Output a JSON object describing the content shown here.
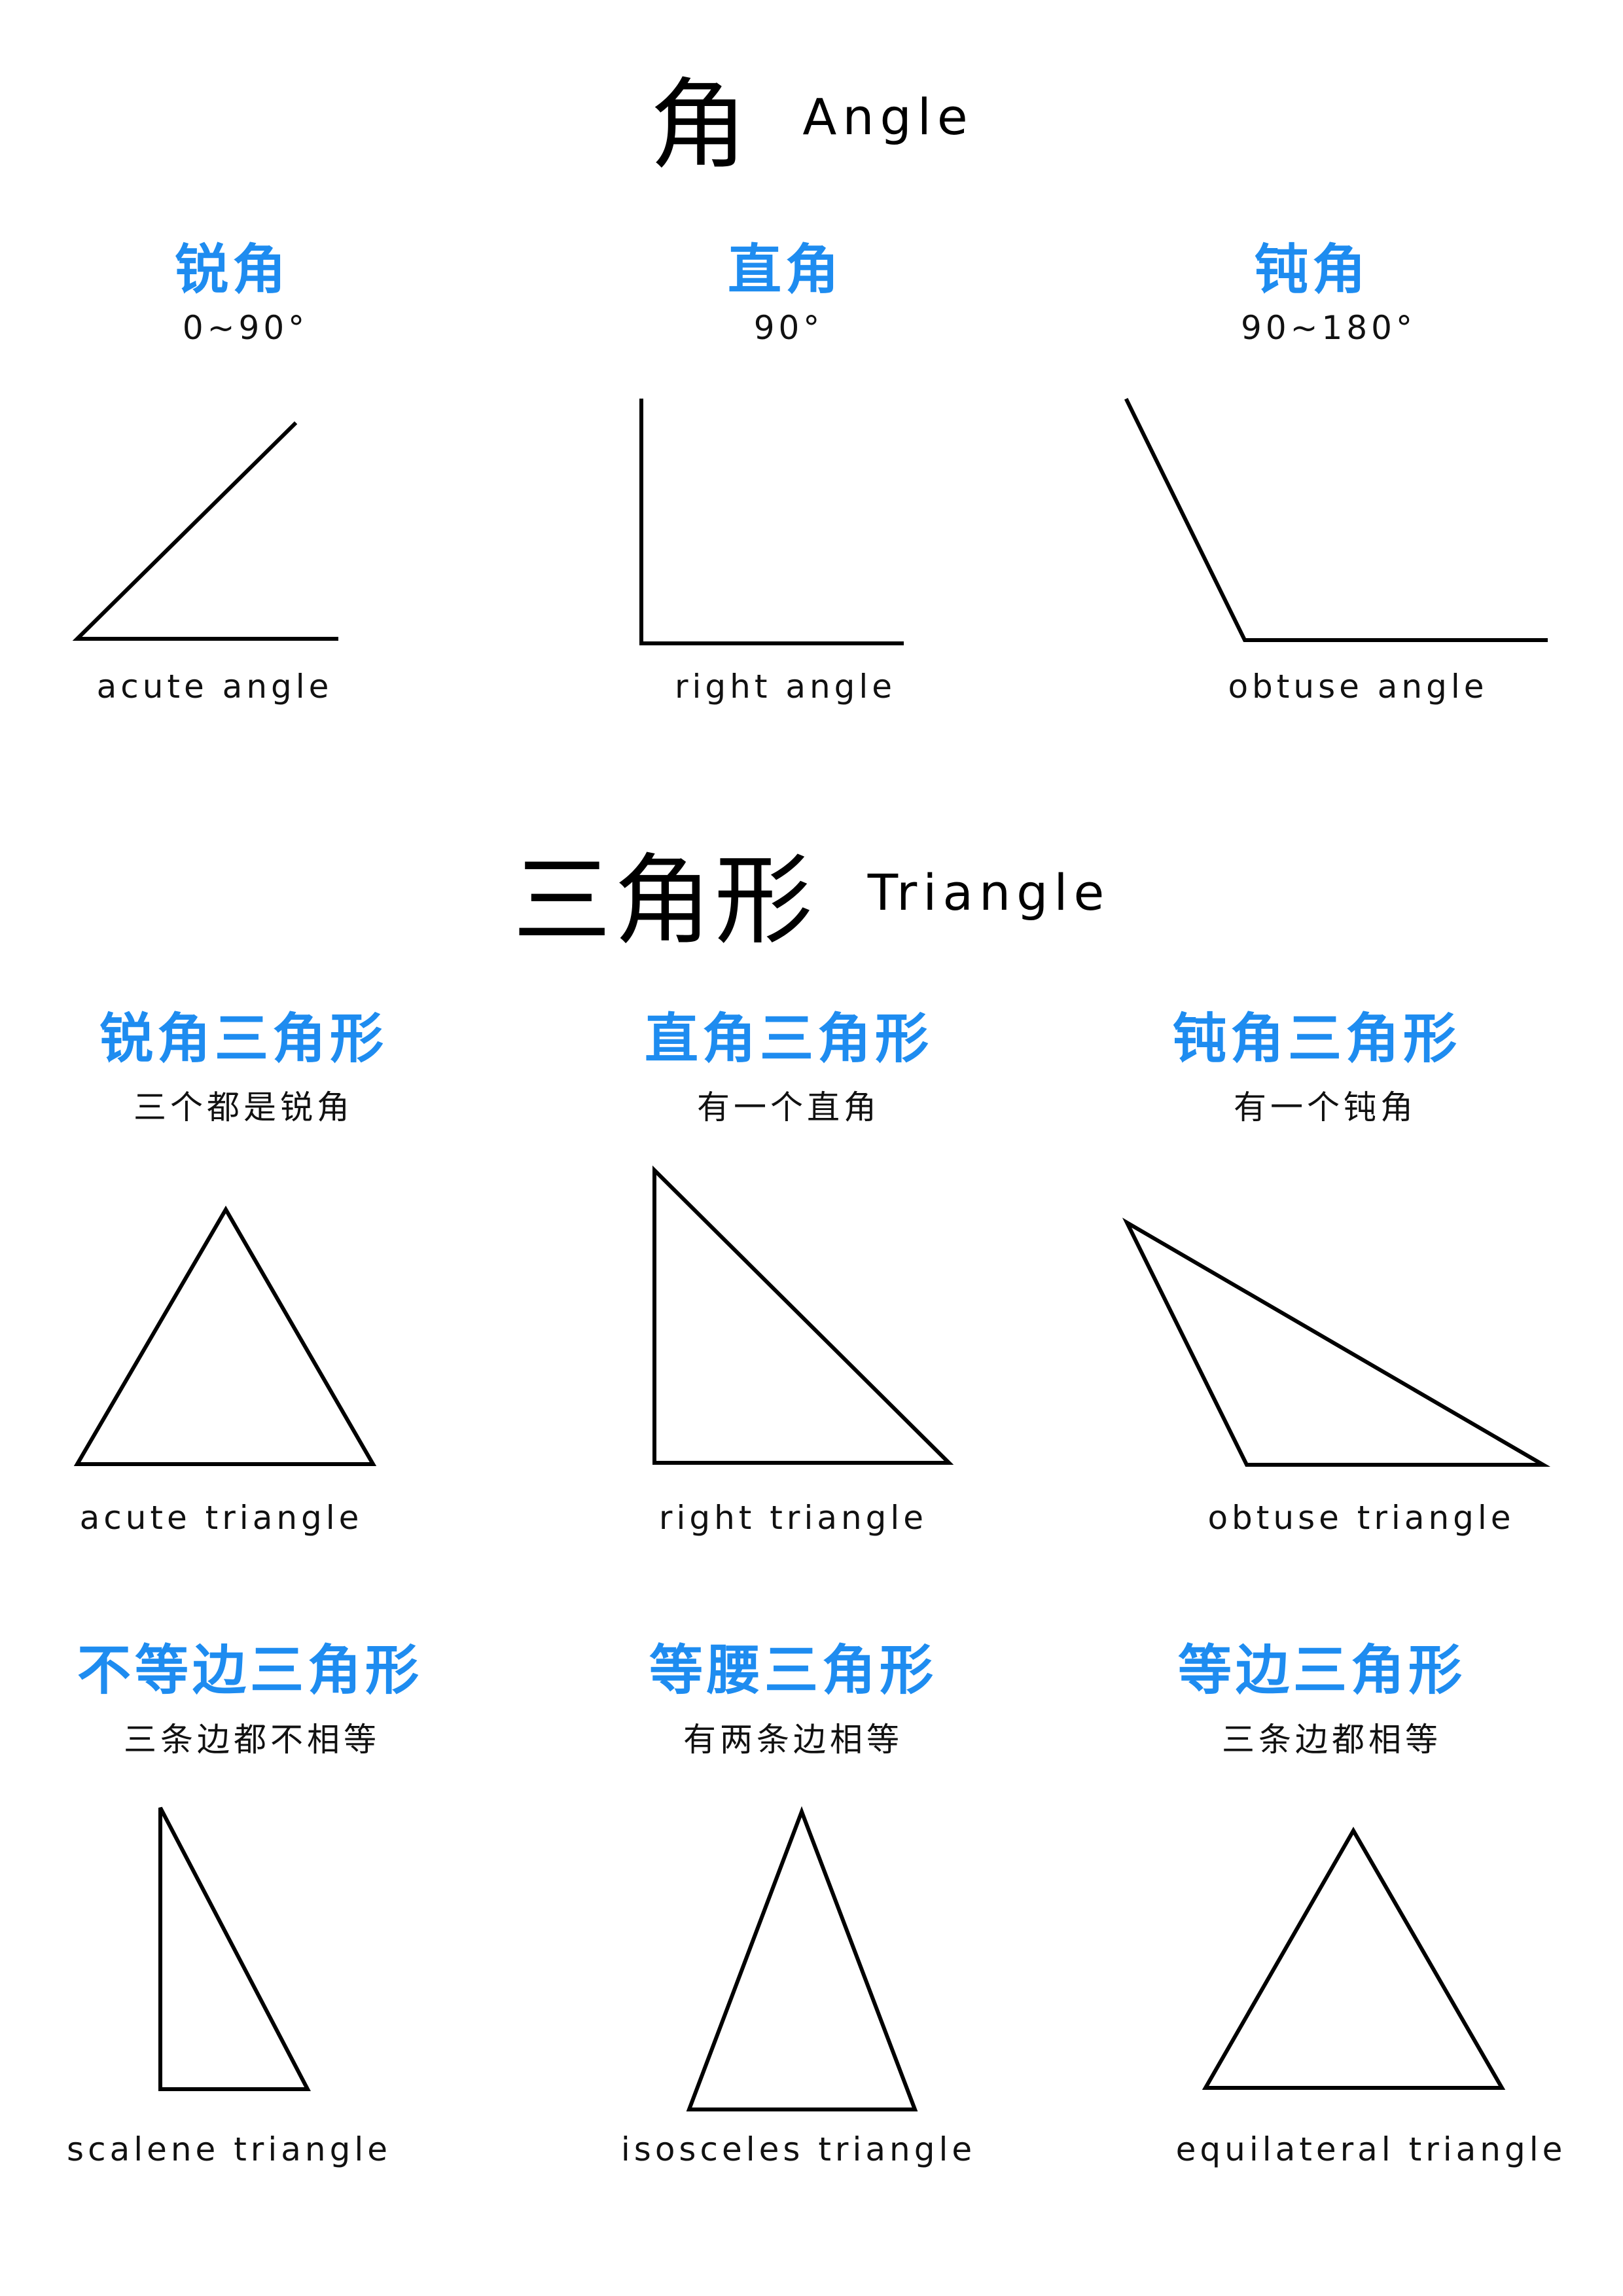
{
  "angle_section": {
    "title_cn": "角",
    "title_en": "Angle",
    "items": [
      {
        "name_cn": "锐角",
        "range": "0~90°",
        "label_en": "acute angle"
      },
      {
        "name_cn": "直角",
        "range": "90°",
        "label_en": "right angle"
      },
      {
        "name_cn": "钝角",
        "range": "90~180°",
        "label_en": "obtuse angle"
      }
    ]
  },
  "triangle_section": {
    "title_cn": "三角形",
    "title_en": "Triangle",
    "by_angle": [
      {
        "name_cn": "锐角三角形",
        "desc_cn": "三个都是锐角",
        "label_en": "acute triangle"
      },
      {
        "name_cn": "直角三角形",
        "desc_cn": "有一个直角",
        "label_en": "right triangle"
      },
      {
        "name_cn": "钝角三角形",
        "desc_cn": "有一个钝角",
        "label_en": "obtuse triangle"
      }
    ],
    "by_side": [
      {
        "name_cn": "不等边三角形",
        "desc_cn": "三条边都不相等",
        "label_en": "scalene triangle"
      },
      {
        "name_cn": "等腰三角形",
        "desc_cn": "有两条边相等",
        "label_en": "isosceles triangle"
      },
      {
        "name_cn": "等边三角形",
        "desc_cn": "三条边都相等",
        "label_en": "equilateral triangle"
      }
    ]
  },
  "colors": {
    "accent": "#1e8cf0",
    "ink": "#000000"
  }
}
